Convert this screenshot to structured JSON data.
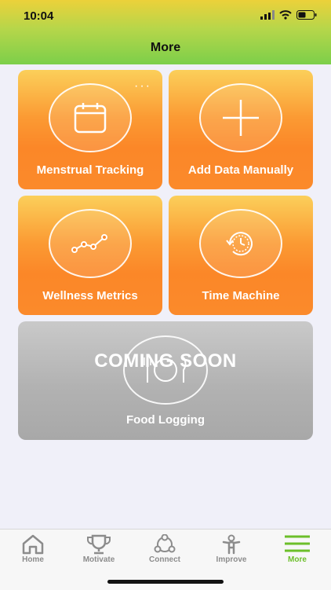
{
  "status_bar": {
    "time": "10:04"
  },
  "header": {
    "title": "More"
  },
  "tiles": [
    {
      "label": "Menstrual Tracking",
      "icon": "calendar-icon",
      "more": "···"
    },
    {
      "label": "Add Data Manually",
      "icon": "plus-icon"
    },
    {
      "label": "Wellness Metrics",
      "icon": "trend-line-icon"
    },
    {
      "label": "Time Machine",
      "icon": "clock-history-icon"
    }
  ],
  "coming_soon": {
    "badge": "COMING SOON",
    "label": "Food Logging",
    "icon": "plate-cutlery-icon"
  },
  "tabbar": {
    "items": [
      {
        "label": "Home",
        "icon": "home-icon",
        "active": false
      },
      {
        "label": "Motivate",
        "icon": "trophy-icon",
        "active": false
      },
      {
        "label": "Connect",
        "icon": "connect-icon",
        "active": false
      },
      {
        "label": "Improve",
        "icon": "person-icon",
        "active": false
      },
      {
        "label": "More",
        "icon": "menu-icon",
        "active": true
      }
    ]
  },
  "colors": {
    "accent": "#6cbf2a",
    "tile_orange": "#fb8a2b",
    "tab_inactive": "#8c8c8c"
  }
}
